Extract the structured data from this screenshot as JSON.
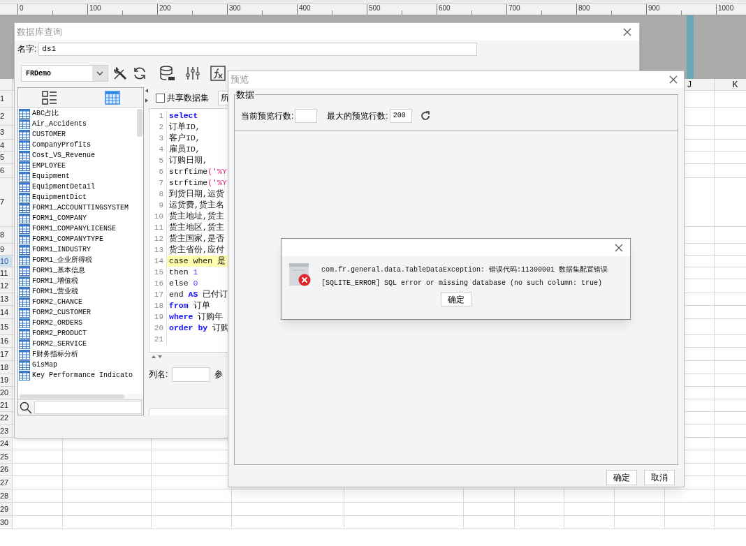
{
  "ruler": {
    "labels": [
      "0",
      "100",
      "200",
      "300",
      "400",
      "500",
      "600",
      "700",
      "800",
      "900",
      "1000"
    ]
  },
  "spreadsheet": {
    "columns": [
      "J",
      "K"
    ],
    "rows": [
      {
        "label": "1",
        "selected": false
      },
      {
        "label": "2",
        "selected": false
      },
      {
        "label": "3",
        "selected": false
      },
      {
        "label": "4",
        "selected": false
      },
      {
        "label": "5",
        "selected": false
      },
      {
        "label": "6",
        "selected": false
      },
      {
        "label": "7",
        "selected": false
      },
      {
        "label": "8",
        "selected": false
      },
      {
        "label": "9",
        "selected": false
      },
      {
        "label": "10",
        "selected": true
      },
      {
        "label": "11",
        "selected": false
      },
      {
        "label": "12",
        "selected": false
      },
      {
        "label": "13",
        "selected": false
      },
      {
        "label": "14",
        "selected": false
      },
      {
        "label": "15",
        "selected": false
      },
      {
        "label": "16",
        "selected": false
      },
      {
        "label": "17",
        "selected": false
      },
      {
        "label": "18",
        "selected": false
      },
      {
        "label": "19",
        "selected": false
      },
      {
        "label": "20",
        "selected": false
      },
      {
        "label": "21",
        "selected": false
      },
      {
        "label": "22",
        "selected": false
      },
      {
        "label": "23",
        "selected": false
      },
      {
        "label": "24",
        "selected": false
      },
      {
        "label": "25",
        "selected": false
      },
      {
        "label": "26",
        "selected": false
      },
      {
        "label": "27",
        "selected": false
      },
      {
        "label": "28",
        "selected": false
      },
      {
        "label": "29",
        "selected": false
      },
      {
        "label": "30",
        "selected": false
      }
    ]
  },
  "query_window": {
    "title": "数据库查询",
    "name_label": "名字:",
    "name_value": "ds1",
    "connection": "FRDemo",
    "toolbar": [
      {
        "kind": "tools"
      },
      {
        "kind": "refresh"
      },
      {
        "kind": "database"
      },
      {
        "kind": "sliders"
      },
      {
        "kind": "formula"
      }
    ],
    "view_toggle": [
      {
        "kind": "list",
        "selected": false
      },
      {
        "kind": "grid",
        "selected": true
      }
    ],
    "tables": [
      "ABC占比",
      "Air_Accidents",
      "CUSTOMER",
      "CompanyProfits",
      "Cost_VS_Revenue",
      "EMPLOYEE",
      "Equipment",
      "EquipmentDetail",
      "EquipmentDict",
      "FORM1_ACCOUNTTINGSYSTEM",
      "FORM1_COMPANY",
      "FORM1_COMPANYLICENSE",
      "FORM1_COMPANYTYPE",
      "FORM1_INDUSTRY",
      "FORM1_企业所得税",
      "FORM1_基本信息",
      "FORM1_增值税",
      "FORM1_营业税",
      "FORM2_CHANCE",
      "FORM2_CUSTOMER",
      "FORM2_ORDERS",
      "FORM2_PRODUCT",
      "FORM2_SERVICE",
      "F财务指标分析",
      "GisMap",
      "Key Performance Indicato"
    ],
    "shared_dataset": {
      "label": "共享数据集",
      "checked": false
    },
    "side_button": "所",
    "code_lines": [
      {
        "number": "1",
        "highlighted": false,
        "tokens": [
          {
            "kind": "keyword",
            "text": "select"
          }
        ]
      },
      {
        "number": "2",
        "highlighted": false,
        "tokens": [
          {
            "kind": "plain",
            "text": "订单ID,"
          }
        ]
      },
      {
        "number": "3",
        "highlighted": false,
        "tokens": [
          {
            "kind": "plain",
            "text": "客户ID,"
          }
        ]
      },
      {
        "number": "4",
        "highlighted": false,
        "tokens": [
          {
            "kind": "plain",
            "text": "雇员ID,"
          }
        ]
      },
      {
        "number": "5",
        "highlighted": false,
        "tokens": [
          {
            "kind": "plain",
            "text": "订购日期,"
          }
        ]
      },
      {
        "number": "6",
        "highlighted": false,
        "tokens": [
          {
            "kind": "plain",
            "text": "strftime"
          },
          {
            "kind": "string",
            "text": "('%Y"
          }
        ]
      },
      {
        "number": "7",
        "highlighted": false,
        "tokens": [
          {
            "kind": "plain",
            "text": "strftime"
          },
          {
            "kind": "string",
            "text": "('%Y"
          }
        ]
      },
      {
        "number": "8",
        "highlighted": false,
        "tokens": [
          {
            "kind": "plain",
            "text": "到货日期,运货"
          }
        ]
      },
      {
        "number": "9",
        "highlighted": false,
        "tokens": [
          {
            "kind": "plain",
            "text": "运货费,货主名"
          }
        ]
      },
      {
        "number": "10",
        "highlighted": false,
        "tokens": [
          {
            "kind": "plain",
            "text": "货主地址,货主"
          }
        ]
      },
      {
        "number": "11",
        "highlighted": false,
        "tokens": [
          {
            "kind": "plain",
            "text": "货主地区,货主"
          }
        ]
      },
      {
        "number": "12",
        "highlighted": false,
        "tokens": [
          {
            "kind": "plain",
            "text": "货主国家,是否"
          }
        ]
      },
      {
        "number": "13",
        "highlighted": false,
        "tokens": [
          {
            "kind": "plain",
            "text": "货主省份,应付"
          }
        ]
      },
      {
        "number": "14",
        "highlighted": true,
        "tokens": [
          {
            "kind": "plain",
            "text": "case when 是"
          }
        ]
      },
      {
        "number": "15",
        "highlighted": false,
        "tokens": [
          {
            "kind": "plain",
            "text": "then "
          },
          {
            "kind": "number",
            "text": "1"
          }
        ]
      },
      {
        "number": "16",
        "highlighted": false,
        "tokens": [
          {
            "kind": "plain",
            "text": "else "
          },
          {
            "kind": "number",
            "text": "0"
          }
        ]
      },
      {
        "number": "17",
        "highlighted": false,
        "tokens": [
          {
            "kind": "plain",
            "text": "end "
          },
          {
            "kind": "keyword",
            "text": "AS"
          },
          {
            "kind": "plain",
            "text": " 已付订"
          }
        ]
      },
      {
        "number": "18",
        "highlighted": false,
        "tokens": [
          {
            "kind": "keyword",
            "text": "from"
          },
          {
            "kind": "plain",
            "text": " 订单"
          }
        ]
      },
      {
        "number": "19",
        "highlighted": false,
        "tokens": [
          {
            "kind": "keyword",
            "text": "where"
          },
          {
            "kind": "plain",
            "text": " 订购年"
          }
        ]
      },
      {
        "number": "20",
        "highlighted": false,
        "tokens": [
          {
            "kind": "keyword",
            "text": "order by"
          },
          {
            "kind": "plain",
            "text": " 订购"
          }
        ]
      },
      {
        "number": "21",
        "highlighted": false
      }
    ],
    "column_label": "列名:",
    "param_label": "参"
  },
  "preview_window": {
    "title": "预览",
    "group": "数据",
    "current_rows_label": "当前预览行数:",
    "max_rows_label": "最大的预览行数:",
    "max_rows_value": "200",
    "buttons": [
      "确定",
      "取消"
    ]
  },
  "error_dialog": {
    "lines": [
      "com.fr.general.data.TableDataException: 错误代码:11300001 数据集配置错误",
      "[SQLITE_ERROR] SQL error or missing database (no such column: true)"
    ],
    "button": "确定"
  }
}
